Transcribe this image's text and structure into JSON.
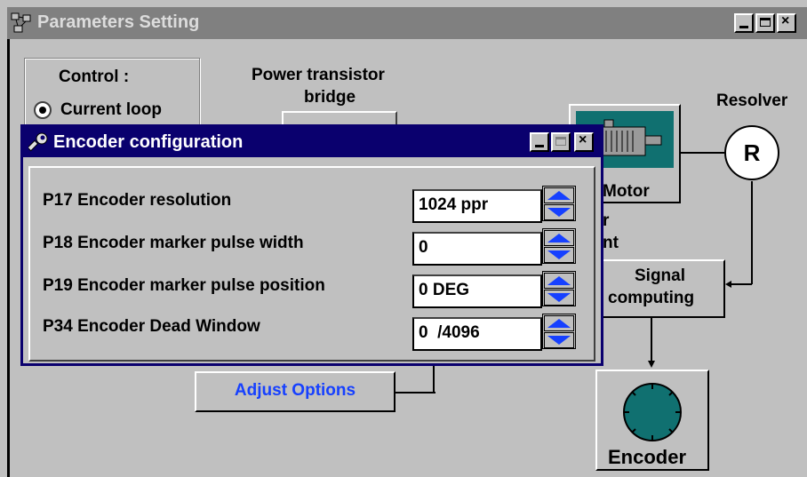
{
  "main_window": {
    "title": "Parameters Setting",
    "control_heading": "Control :",
    "control_option": "Current loop",
    "power_label_line1": "Power transistor",
    "power_label_line2": "bridge",
    "resolver_label": "Resolver",
    "resolver_symbol": "R",
    "motor_label": "Motor",
    "partial_text_1": "r",
    "partial_text_2": "nt",
    "signal_label_line1": "Signal",
    "signal_label_line2": "computing",
    "adjust_options_label": "Adjust Options",
    "encoder_label": "Encoder"
  },
  "dialog": {
    "title": "Encoder configuration",
    "parameters": [
      {
        "label": "P17  Encoder resolution",
        "value": "1024 ppr"
      },
      {
        "label": "P18  Encoder marker pulse width",
        "value": "0"
      },
      {
        "label": "P19  Encoder marker pulse position",
        "value": "0 DEG"
      },
      {
        "label": "P34  Encoder Dead Window",
        "value": "0  /4096"
      }
    ]
  },
  "colors": {
    "title_active": "#0a006e",
    "title_inactive": "#808080",
    "window_face": "#c0c0c0",
    "accent_blue": "#1640ff",
    "teal": "#107070"
  },
  "icons": {
    "main_window_icon": "network-settings-icon",
    "dialog_icon": "wrench-icon"
  }
}
